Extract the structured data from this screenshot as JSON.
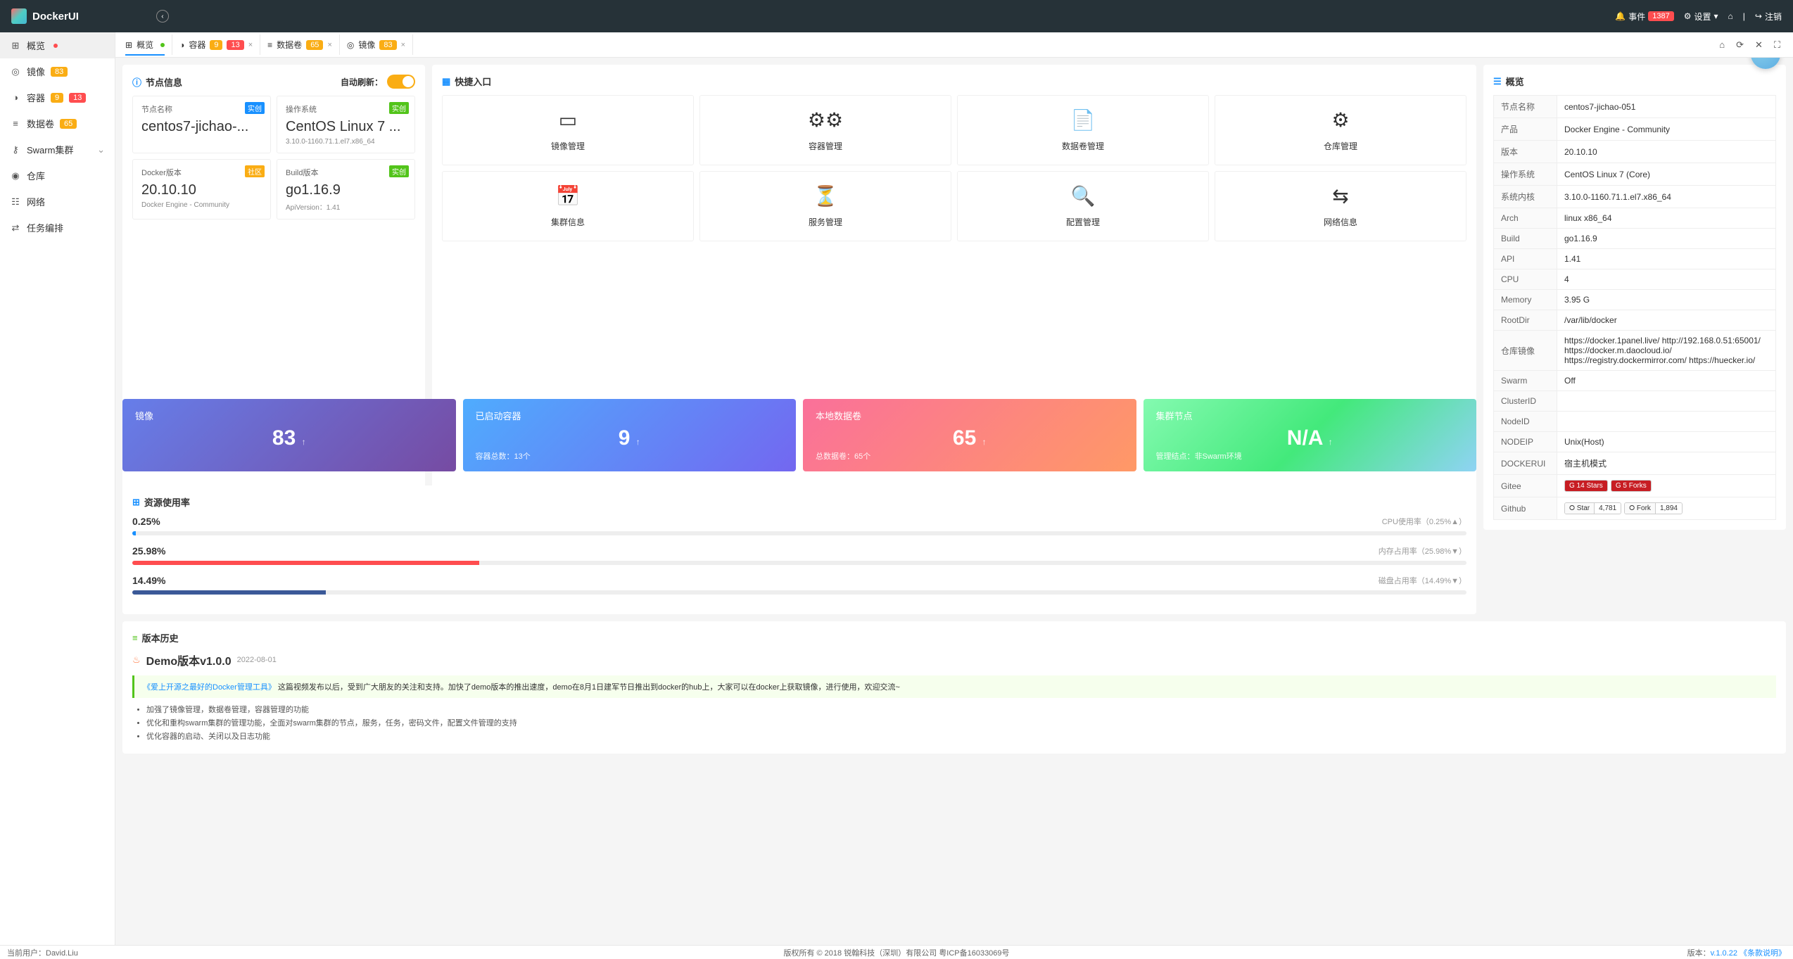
{
  "brand": "DockerUI",
  "topbar": {
    "events_label": "事件",
    "events_count": "1387",
    "settings_label": "设置",
    "logout_label": "注销"
  },
  "sidebar": [
    {
      "icon": "⊞",
      "label": "概览",
      "badges": [],
      "dot": "red"
    },
    {
      "icon": "◎",
      "label": "镜像",
      "badges": [
        {
          "v": "83",
          "c": "bg-orange"
        }
      ]
    },
    {
      "icon": "◑",
      "label": "容器",
      "badges": [
        {
          "v": "9",
          "c": "bg-orange"
        },
        {
          "v": "13",
          "c": "bg-red"
        }
      ]
    },
    {
      "icon": "≡",
      "label": "数据卷",
      "badges": [
        {
          "v": "65",
          "c": "bg-orange"
        }
      ]
    },
    {
      "icon": "⚷",
      "label": "Swarm集群",
      "badges": [],
      "expand": true
    },
    {
      "icon": "◉",
      "label": "仓库",
      "badges": []
    },
    {
      "icon": "☷",
      "label": "网络",
      "badges": []
    },
    {
      "icon": "⇄",
      "label": "任务编排",
      "badges": []
    }
  ],
  "tabs": [
    {
      "icon": "⊞",
      "label": "概览",
      "dot": true,
      "active": true,
      "closable": false
    },
    {
      "icon": "◑",
      "label": "容器",
      "badges": [
        {
          "v": "9",
          "c": "bg-orange"
        },
        {
          "v": "13",
          "c": "bg-red"
        }
      ],
      "closable": true
    },
    {
      "icon": "≡",
      "label": "数据卷",
      "badges": [
        {
          "v": "65",
          "c": "bg-orange"
        }
      ],
      "closable": true
    },
    {
      "icon": "◎",
      "label": "镜像",
      "badges": [
        {
          "v": "83",
          "c": "bg-orange"
        }
      ],
      "closable": true
    }
  ],
  "node_header": "节点信息",
  "auto_refresh": "自动刷新：",
  "node": {
    "name_l": "节点名称",
    "name_v": "centos7-jichao-...",
    "name_chip": "实创",
    "os_l": "操作系统",
    "os_v": "CentOS Linux 7 ...",
    "os_sub": "3.10.0-1160.71.1.el7.x86_64",
    "os_chip": "实创",
    "dv_l": "Docker版本",
    "dv_v": "20.10.10",
    "dv_sub": "Docker Engine - Community",
    "dv_chip": "社区",
    "bv_l": "Build版本",
    "bv_v": "go1.16.9",
    "bv_sub": "ApiVersion：1.41",
    "bv_chip": "实创"
  },
  "quick_h": "快捷入口",
  "quick": [
    {
      "ico": "▭",
      "lbl": "镜像管理"
    },
    {
      "ico": "⚙⚙",
      "lbl": "容器管理"
    },
    {
      "ico": "📄",
      "lbl": "数据卷管理"
    },
    {
      "ico": "⚙",
      "lbl": "仓库管理"
    },
    {
      "ico": "📅",
      "lbl": "集群信息"
    },
    {
      "ico": "⏳",
      "lbl": "服务管理"
    },
    {
      "ico": "🔍",
      "lbl": "配置管理"
    },
    {
      "ico": "⇆",
      "lbl": "网络信息"
    }
  ],
  "over_h": "概览",
  "over_rows": [
    [
      "节点名称",
      "centos7-jichao-051"
    ],
    [
      "产品",
      "Docker Engine - Community"
    ],
    [
      "版本",
      "20.10.10"
    ],
    [
      "操作系统",
      "CentOS Linux 7 (Core)"
    ],
    [
      "系统内核",
      "3.10.0-1160.71.1.el7.x86_64"
    ],
    [
      "Arch",
      "linux x86_64"
    ],
    [
      "Build",
      "go1.16.9"
    ],
    [
      "API",
      "1.41"
    ],
    [
      "CPU",
      "4"
    ],
    [
      "Memory",
      "3.95 G"
    ],
    [
      "RootDir",
      "/var/lib/docker"
    ],
    [
      "仓库镜像",
      "https://docker.1panel.live/ http://192.168.0.51:65001/ https://docker.m.daocloud.io/ https://registry.dockermirror.com/ https://huecker.io/"
    ],
    [
      "Swarm",
      "Off"
    ],
    [
      "ClusterID",
      ""
    ],
    [
      "NodeID",
      ""
    ],
    [
      "NODEIP",
      "Unix(Host)"
    ],
    [
      "DOCKERUI",
      "宿主机模式"
    ]
  ],
  "gitee_l": "Gitee",
  "gitee_stars": "14 Stars",
  "gitee_forks": "5 Forks",
  "github_l": "Github",
  "github_star_l": "Star",
  "github_star_v": "4,781",
  "github_fork_l": "Fork",
  "github_fork_v": "1,894",
  "stats": [
    {
      "t": "镜像",
      "v": "83",
      "f": ""
    },
    {
      "t": "已启动容器",
      "v": "9",
      "f": "容器总数：13个"
    },
    {
      "t": "本地数据卷",
      "v": "65",
      "f": "总数据卷：65个"
    },
    {
      "t": "集群节点",
      "v": "N/A",
      "f": "管理结点：非Swarm环境"
    }
  ],
  "res_h": "资源使用率",
  "res": [
    {
      "pct": "0.25%",
      "meta": "CPU使用率（0.25%▲）",
      "w": 0.25,
      "color": "#1890ff"
    },
    {
      "pct": "25.98%",
      "meta": "内存占用率（25.98%▼）",
      "w": 25.98,
      "color": "#ff4d4f"
    },
    {
      "pct": "14.49%",
      "meta": "磁盘占用率（14.49%▼）",
      "w": 14.49,
      "color": "#3b5998"
    }
  ],
  "hist_h": "版本历史",
  "hist_title": "Demo版本v1.0.0",
  "hist_date": "2022-08-01",
  "hist_link": "《爱上开源之最好的Docker管理工具》",
  "hist_body": "这篇视频发布以后，受到广大朋友的关注和支持。加快了demo版本的推出速度，demo在8月1日建军节日推出到docker的hub上，大家可以在docker上获取镜像，进行使用，欢迎交流~",
  "hist_items": [
    "加强了镜像管理，数据卷管理，容器管理的功能",
    "优化和重构swarm集群的管理功能，全面对swarm集群的节点，服务，任务，密码文件，配置文件管理的支持",
    "优化容器的启动、关闭以及日志功能"
  ],
  "footer": {
    "user_l": "当前用户：",
    "user_v": "David.Liu",
    "center": "版权所有 © 2018 锐翰科技（深圳）有限公司 粤ICP备16033069号",
    "ver_l": "版本：",
    "ver_v": "v.1.0.22",
    "terms": "《条款说明》"
  }
}
